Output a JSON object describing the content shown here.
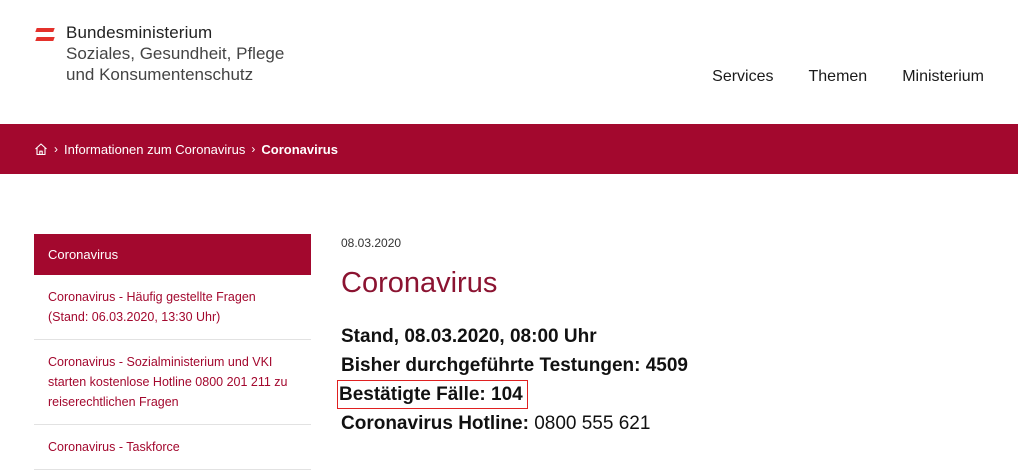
{
  "header": {
    "logo_line1": "Bundesministerium",
    "logo_line2": "Soziales, Gesundheit, Pflege",
    "logo_line3": "und Konsumentenschutz",
    "nav": [
      "Services",
      "Themen",
      "Ministerium"
    ]
  },
  "breadcrumb": {
    "home_icon": "home-icon",
    "items": [
      "Informationen zum Coronavirus",
      "Coronavirus"
    ]
  },
  "sidebar": {
    "active": "Coronavirus",
    "items": [
      "Coronavirus - Häufig gestellte Fragen (Stand: 06.03.2020, 13:30 Uhr)",
      "Coronavirus - Sozialministerium und VKI starten kostenlose Hotline 0800 201 211 zu reiserechtlichen Fragen",
      "Coronavirus - Taskforce"
    ]
  },
  "main": {
    "date": "08.03.2020",
    "title": "Coronavirus",
    "stand": "Stand, 08.03.2020, 08:00 Uhr",
    "tests_label": "Bisher durchgeführte Testungen:",
    "tests_value": "4509",
    "cases_label": "Bestätigte Fälle:",
    "cases_value": "104",
    "hotline_label": "Coronavirus Hotline:",
    "hotline_value": "0800 555 621"
  },
  "colors": {
    "brand": "#a3082e",
    "title": "#8b1331",
    "highlight_box": "#e02020",
    "logo_red": "#e4312b"
  }
}
